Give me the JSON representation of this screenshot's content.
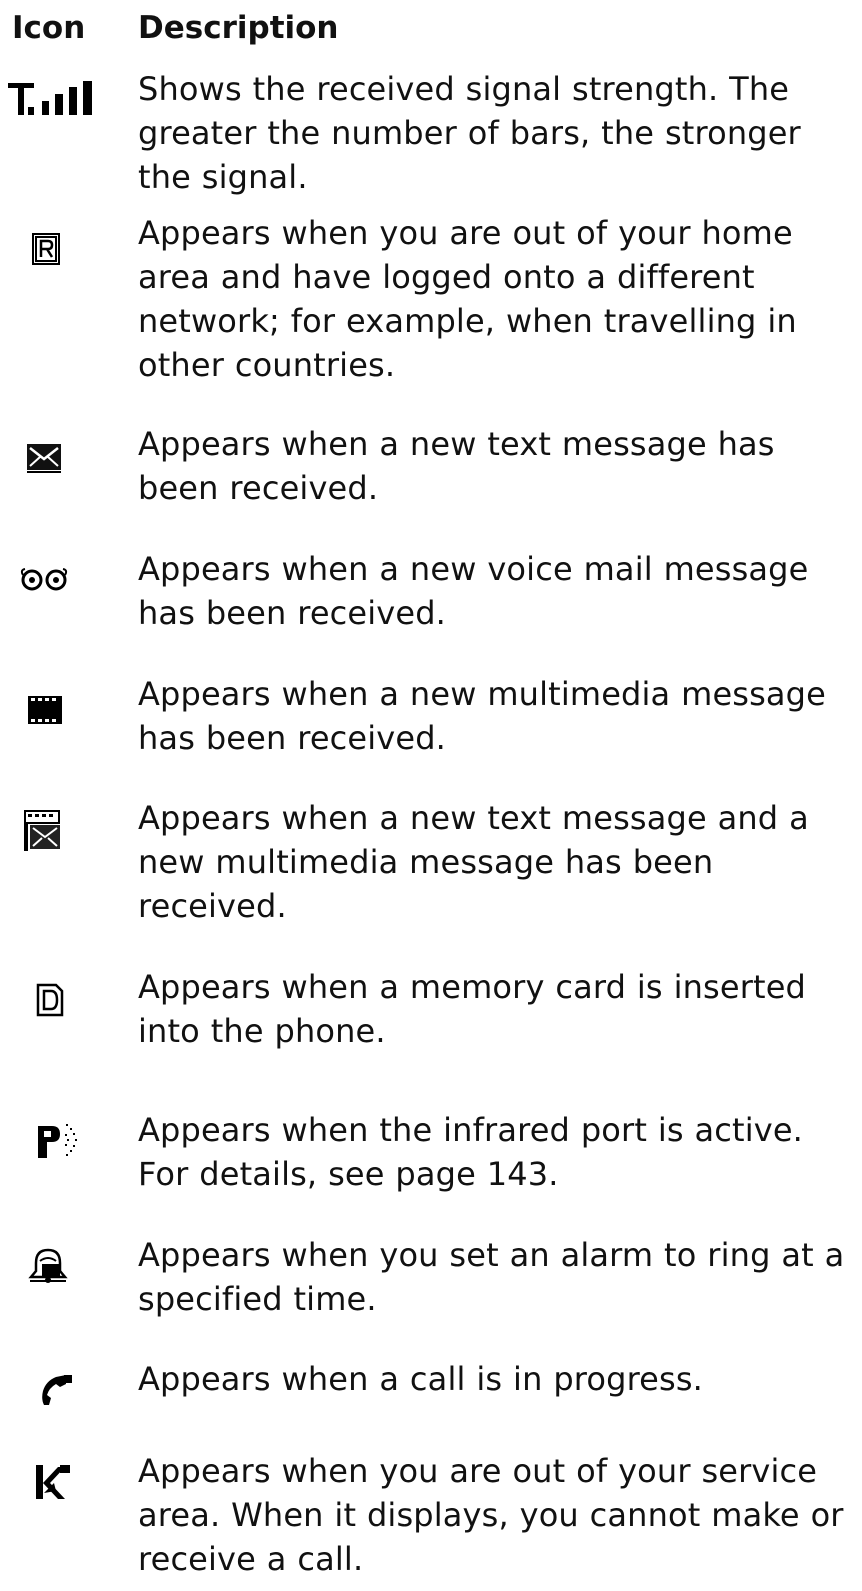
{
  "header": {
    "icon_label": "Icon",
    "description_label": "Description"
  },
  "rows": [
    {
      "icon": "signal-strength-icon",
      "description": "Shows the received signal strength. The greater the number of bars, the stronger the signal."
    },
    {
      "icon": "roaming-icon",
      "description": "Appears when you are out of your home area and have logged onto a different network; for example, when travelling in other countries."
    },
    {
      "icon": "text-message-icon",
      "description": "Appears when a new text message has been received."
    },
    {
      "icon": "voice-mail-icon",
      "description": "Appears when a new voice mail message has been received."
    },
    {
      "icon": "multimedia-message-icon",
      "description": "Appears when a new multimedia message has been received."
    },
    {
      "icon": "text-and-multimedia-message-icon",
      "description": "Appears when a new text message and a new multimedia message has been received."
    },
    {
      "icon": "memory-card-icon",
      "description": "Appears when a memory card is inserted into the phone."
    },
    {
      "icon": "infrared-icon",
      "description": "Appears when the infrared port is active. For details, see page 143."
    },
    {
      "icon": "alarm-icon",
      "description": "Appears when you set an alarm to ring at a specified time."
    },
    {
      "icon": "call-in-progress-icon",
      "description": "Appears when a call is in progress."
    },
    {
      "icon": "no-service-icon",
      "description": "Appears when you are out of your service area. When it displays, you cannot make or receive a call."
    }
  ]
}
